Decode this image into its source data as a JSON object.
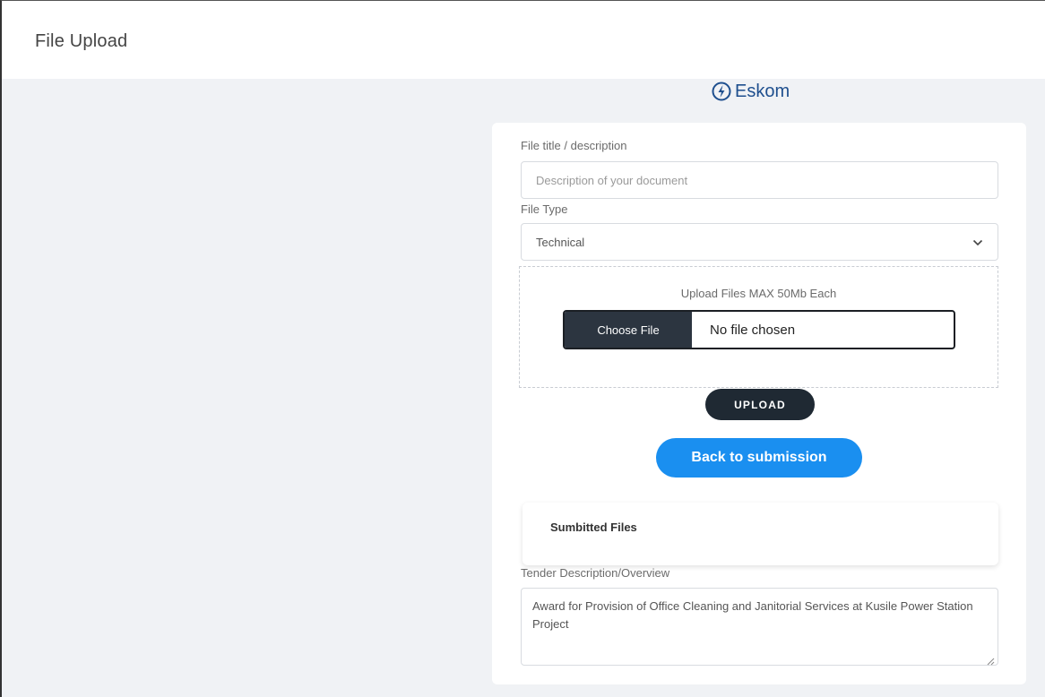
{
  "header": {
    "title": "File Upload"
  },
  "logo": {
    "text": "Eskom"
  },
  "form": {
    "title_label": "File title / description",
    "title_placeholder": "Description of your document",
    "type_label": "File Type",
    "type_value": "Technical",
    "dropzone_text": "Upload Files MAX 50Mb Each",
    "choose_label": "Choose File",
    "file_status": "No file chosen",
    "upload_label": "UPLOAD",
    "back_label": "Back to submission"
  },
  "submitted": {
    "title": "Sumbitted Files"
  },
  "tender": {
    "label": "Tender Description/Overview",
    "text": "Award for Provision of Office Cleaning and Janitorial Services at Kusile Power Station Project"
  },
  "colors": {
    "accent": "#1a8ff0",
    "dark_button": "#1f2933",
    "logo": "#1e4f8e",
    "background": "#f0f2f5"
  },
  "icons": {
    "logo": "eskom-logo-icon",
    "select_arrow": "chevron-down-icon",
    "resize": "resize-grip-icon"
  }
}
